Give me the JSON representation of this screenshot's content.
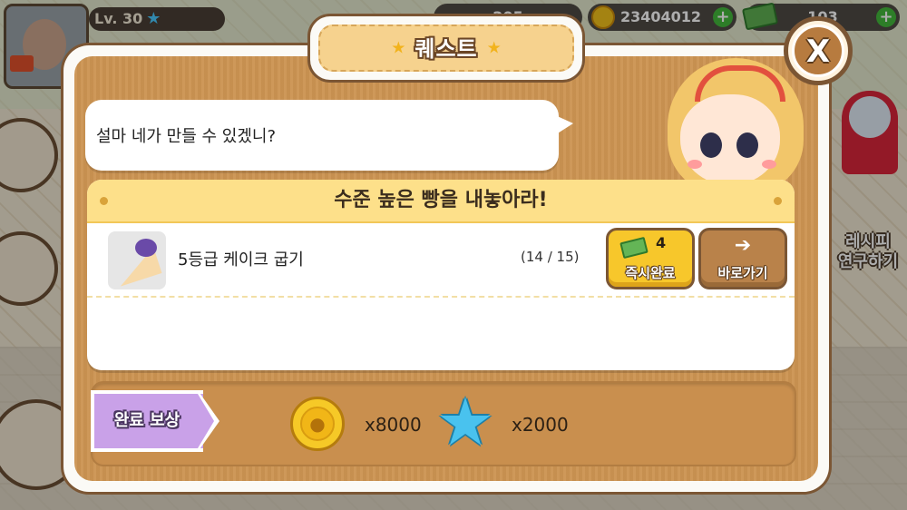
{
  "hud": {
    "level": "Lv. 30",
    "currency1": "205",
    "gold": "23404012",
    "cash": "103"
  },
  "side": {
    "recipe_label": "레시피\n연구하기"
  },
  "dialog": {
    "title": "퀘스트",
    "close_label": "X",
    "speech": "설마 네가 만들 수 있겠니?",
    "quest": {
      "header": "수준 높은 빵을 내놓아라!",
      "task": "5등급 케이크 굽기",
      "progress": "(14 / 15)",
      "instant_cost": "4",
      "instant_label": "즉시완료",
      "goto_label": "바로가기",
      "goto_arrow": "➔"
    },
    "reward": {
      "label": "완료 보상",
      "gold": "x8000",
      "star": "x2000"
    }
  },
  "colors": {
    "panel": "#cc9452",
    "header_yellow": "#fde08a",
    "complete_btn": "#f7c72b",
    "goto_btn": "#b9824a",
    "reward_flag": "#c9a1e8",
    "star_blue": "#49c2ee"
  }
}
